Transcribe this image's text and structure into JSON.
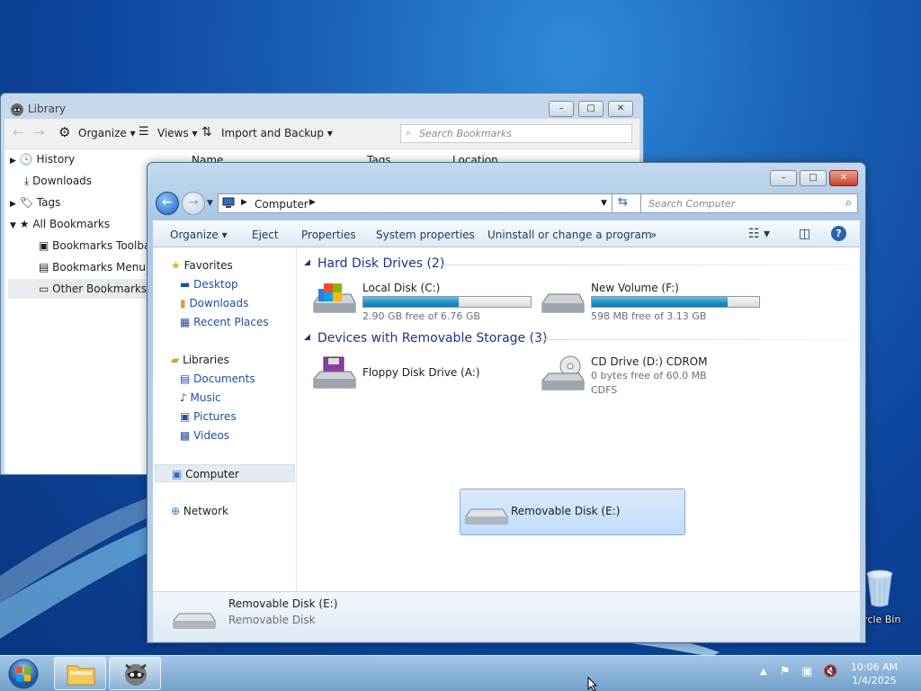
{
  "desktop": {
    "recycle_bin": "ycle Bin"
  },
  "library": {
    "title": "Library",
    "toolbar": {
      "organize": "Organize",
      "views": "Views",
      "import_backup": "Import and Backup"
    },
    "search_placeholder": "Search Bookmarks",
    "tree": [
      "History",
      "Downloads",
      "Tags",
      "All Bookmarks",
      "Bookmarks Toolba",
      "Bookmarks Menu",
      "Other Bookmarks"
    ],
    "columns": [
      "Name",
      "Tags",
      "Location"
    ]
  },
  "explorer": {
    "breadcrumb": "Computer",
    "search_placeholder": "Search Computer",
    "commands": [
      "Organize",
      "Eject",
      "Properties",
      "System properties",
      "Uninstall or change a program",
      "»"
    ],
    "nav": {
      "favorites": "Favorites",
      "favorites_items": [
        "Desktop",
        "Downloads",
        "Recent Places"
      ],
      "libraries": "Libraries",
      "libraries_items": [
        "Documents",
        "Music",
        "Pictures",
        "Videos"
      ],
      "computer": "Computer",
      "network": "Network"
    },
    "groups": {
      "hdd": "Hard Disk Drives (2)",
      "removable": "Devices with Removable Storage (3)"
    },
    "drives": {
      "c": {
        "name": "Local Disk (C:)",
        "status": "2.90 GB free of 6.76 GB",
        "used_fraction": 0.57
      },
      "f": {
        "name": "New Volume (F:)",
        "status": "598 MB free of 3.13 GB",
        "used_fraction": 0.81
      },
      "a": {
        "name": "Floppy Disk Drive (A:)"
      },
      "d": {
        "name": "CD Drive (D:) CDROM",
        "status": "0 bytes free of 60.0 MB",
        "fs": "CDFS"
      },
      "e": {
        "name": "Removable Disk (E:)"
      }
    },
    "details": {
      "name": "Removable Disk (E:)",
      "type": "Removable Disk"
    }
  },
  "taskbar": {
    "time": "10:06 AM",
    "date": "1/4/2025"
  },
  "colors": {
    "accent": "#1e3287",
    "bar_fill": "#1c8fc6",
    "link": "#1e4fa3"
  }
}
